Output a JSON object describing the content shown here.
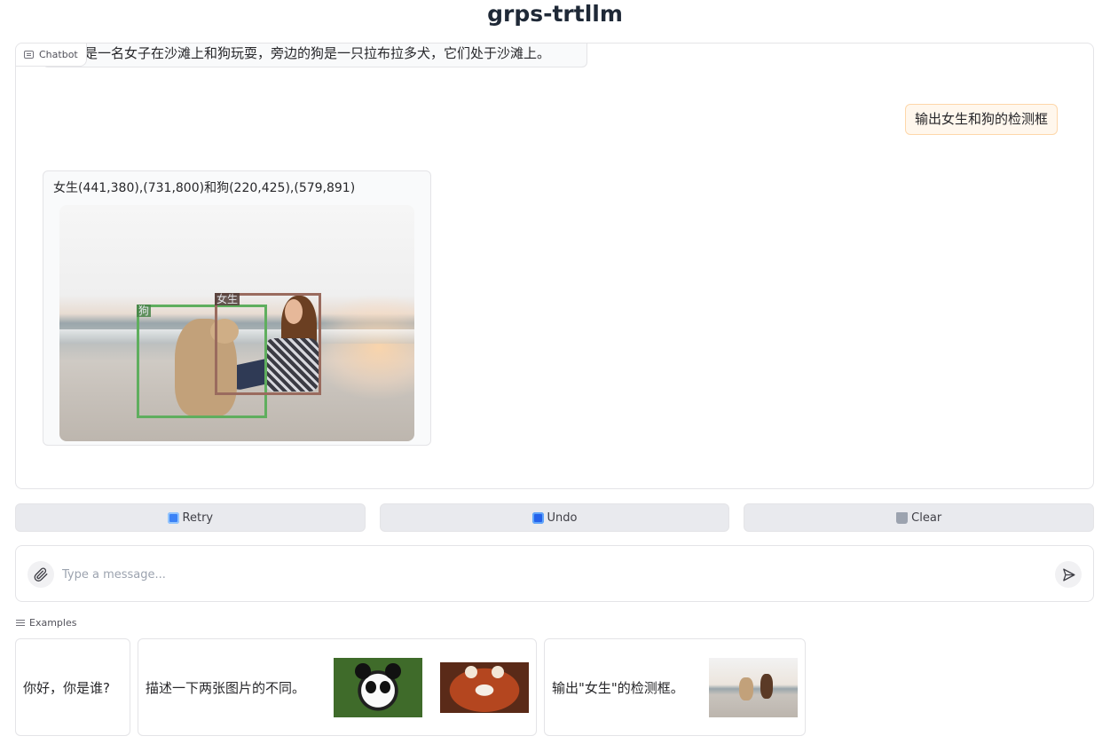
{
  "app": {
    "title": "grps-trtllm"
  },
  "chatbot": {
    "label": "Chatbot",
    "messages": [
      {
        "role": "assistant",
        "text": "是一名女子在沙滩上和狗玩耍，旁边的狗是一只拉布拉多犬，它们处于沙滩上。"
      },
      {
        "role": "user",
        "text": "输出女生和狗的检测框"
      },
      {
        "role": "assistant",
        "text": "女生(441,380),(731,800)和狗(220,425),(579,891)",
        "image": {
          "subject": "woman-and-dog-on-beach",
          "detections": [
            {
              "label": "狗",
              "color": "#5fae5e"
            },
            {
              "label": "女生",
              "color": "#9a6b5e"
            }
          ]
        }
      }
    ]
  },
  "actions": {
    "retry": "Retry",
    "undo": "Undo",
    "clear": "Clear"
  },
  "input": {
    "placeholder": "Type a message...",
    "value": ""
  },
  "examples": {
    "label": "Examples",
    "items": [
      {
        "text": "你好，你是谁?"
      },
      {
        "text": "描述一下两张图片的不同。",
        "images": [
          "panda",
          "red-panda"
        ]
      },
      {
        "text": "输出\"女生\"的检测框。",
        "images": [
          "woman-and-dog-on-beach"
        ]
      }
    ]
  },
  "colors": {
    "user_bubble_bg": "#fff7ed",
    "user_bubble_border": "#fed7aa",
    "button_bg": "#e9eaee"
  }
}
